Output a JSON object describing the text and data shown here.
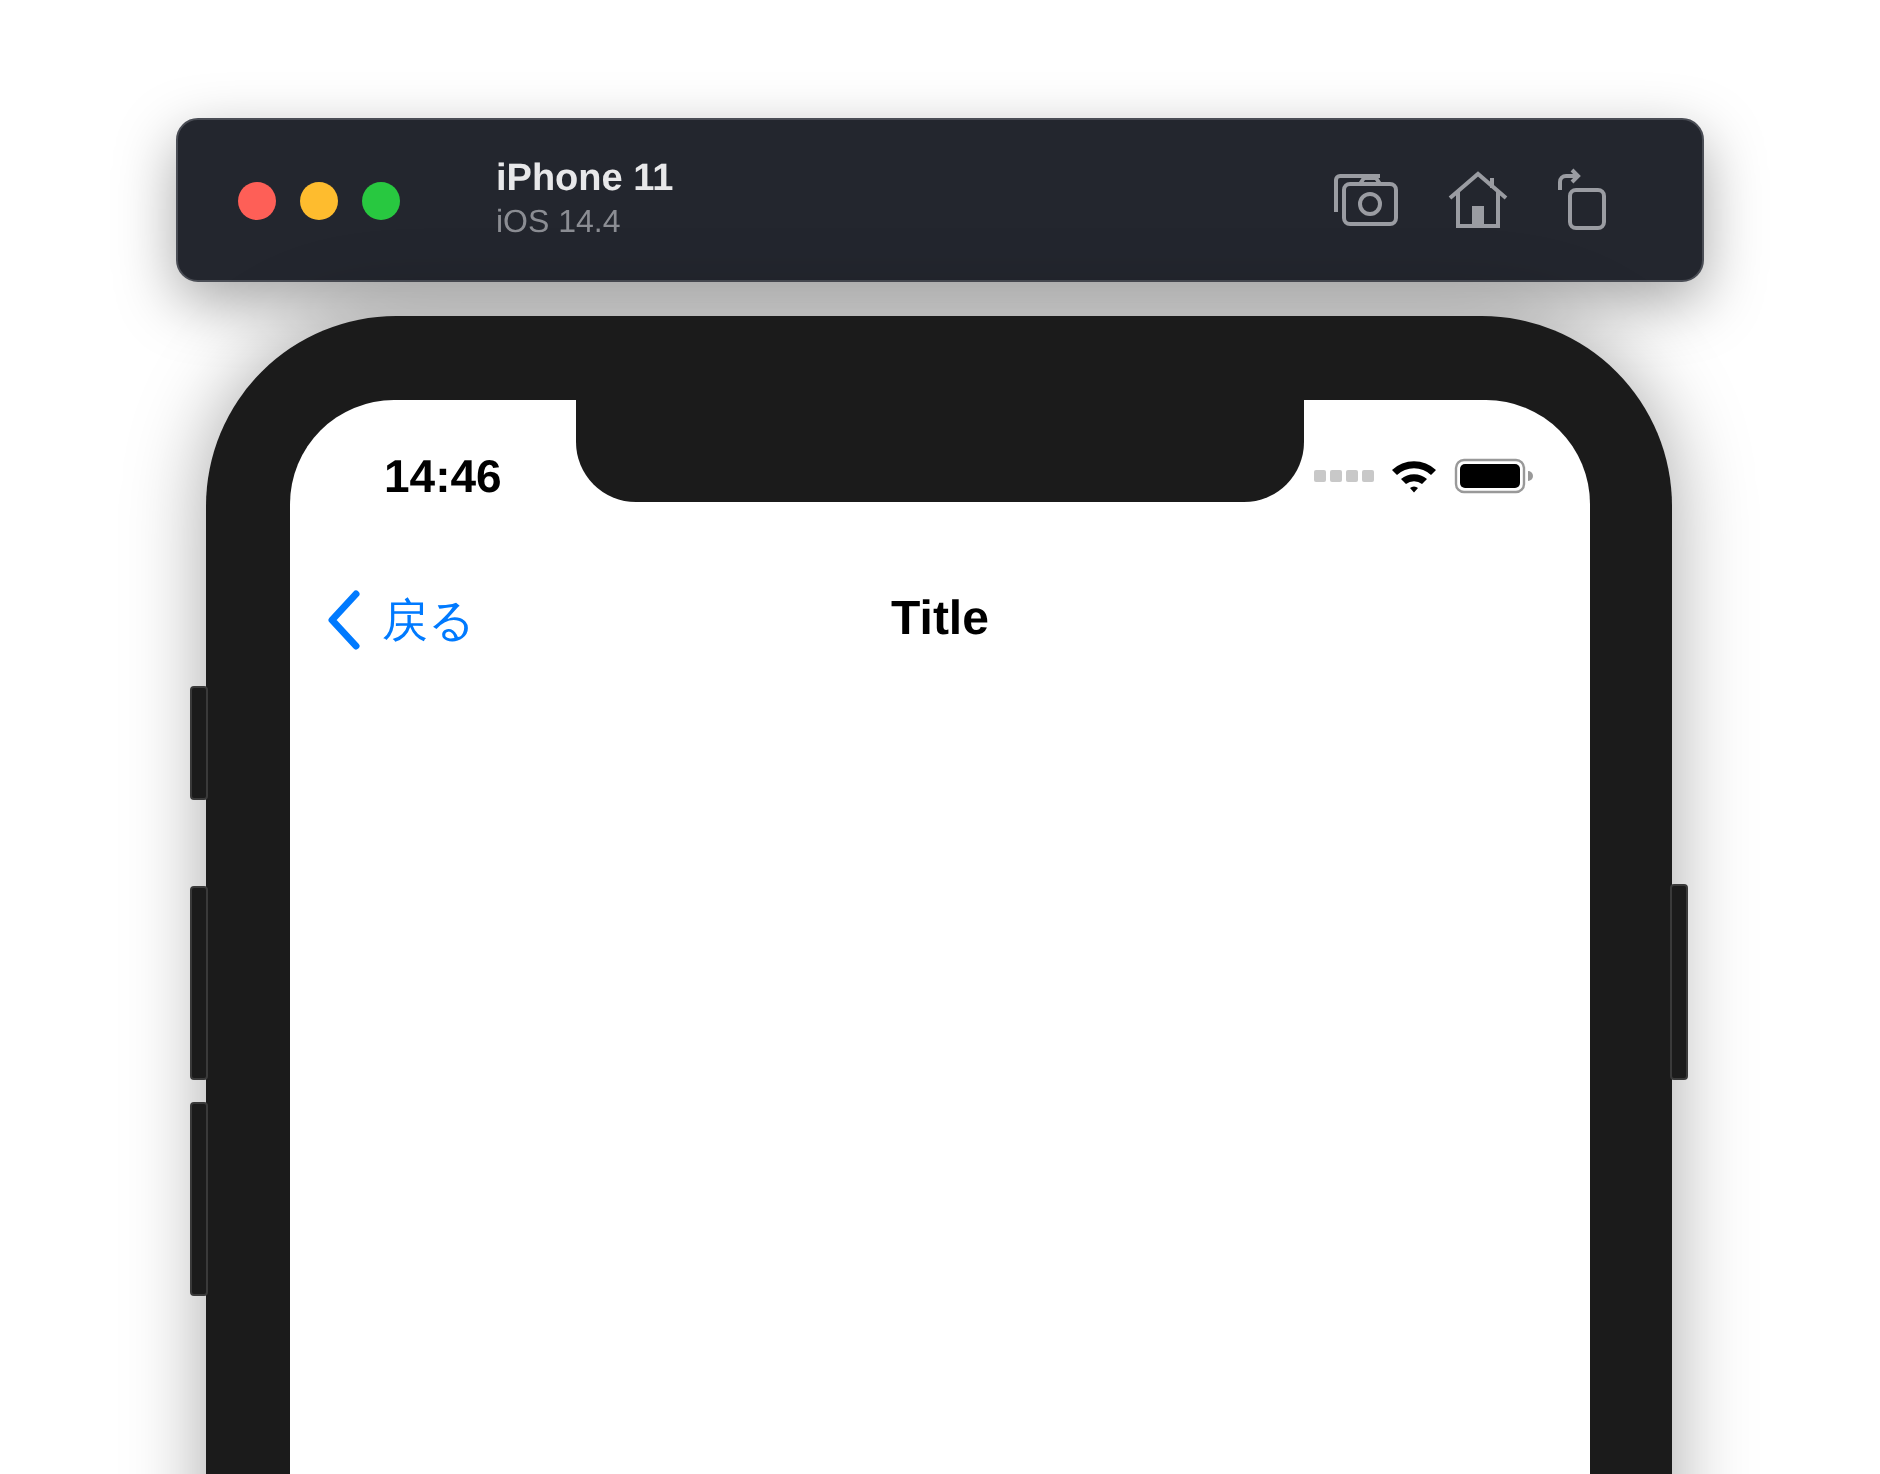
{
  "simulator": {
    "device_name": "iPhone 11",
    "os_version": "iOS 14.4"
  },
  "status_bar": {
    "time": "14:46"
  },
  "nav_bar": {
    "back_label": "戻る",
    "title": "Title"
  }
}
